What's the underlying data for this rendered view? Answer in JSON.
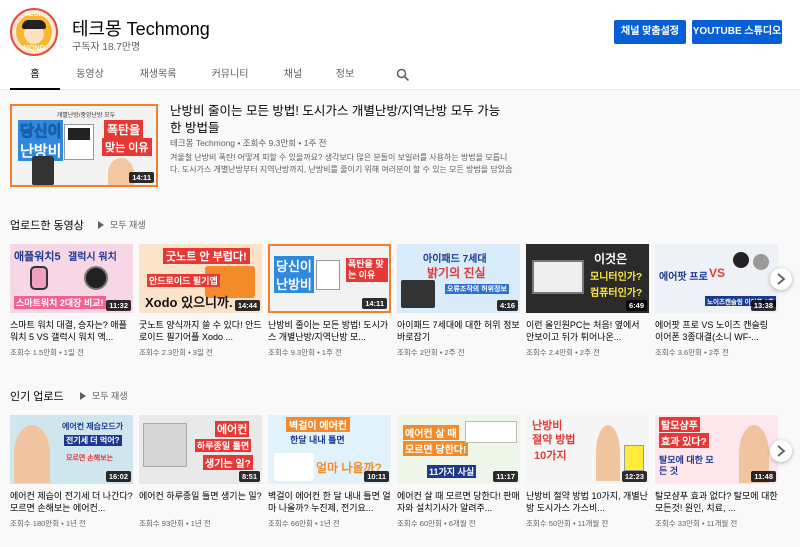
{
  "channel": {
    "avatar_text_top": "TECH",
    "avatar_text_bottom": "MONG",
    "name": "테크몽 Techmong",
    "subscribers": "구독자 18.7만명",
    "customize_label": "채널 맞춤설정",
    "studio_label": "YOUTUBE 스튜디오"
  },
  "tabs": [
    {
      "label": "홈"
    },
    {
      "label": "동영상"
    },
    {
      "label": "재생목록"
    },
    {
      "label": "커뮤니티"
    },
    {
      "label": "채널"
    },
    {
      "label": "정보"
    }
  ],
  "featured": {
    "title": "난방비 줄이는 모든 방법! 도시가스 개별난방/지역난방 모두 가능한 방법들",
    "meta": "테크몽 Techmong • 조회수 9.3만회 • 1주 전",
    "description_1": "겨울철 난방비 폭탄! 어떻게 피할 수 있을까요? 생각보다 많은 분들이 보일러를 사용하는 방법을 모릅니",
    "description_2": "다. 도시가스 개별난방부터 지역난방까지, 난방비를 줄이기 위해 여러분이 할 수 있는 모든 방법을 담았습",
    "duration": "14:11",
    "thumb_text_1": "당신이",
    "thumb_text_2": "난방비",
    "thumb_text_3": "폭탄을",
    "thumb_text_4": "맞는 이유",
    "thumb_text_top": "개별난방/중앙난방 모두"
  },
  "uploads": {
    "title": "업로드한 동영상",
    "play_all": "모두 재생",
    "videos": [
      {
        "title": "스마트 워치 대결, 승자는? 애플워치 5 VS 갤럭시 워치 액...",
        "meta": "조회수 1.5만회 • 1일 전",
        "duration": "11:32",
        "t1": "애플워치5",
        "t2": "갤럭시 워치",
        "t3": "스마트워치 2대장 비교!"
      },
      {
        "title": "굿노트 양식까지 쓸 수 있다! 안드로이드 필기어플 Xodo ...",
        "meta": "조회수 2.3만회 • 3일 전",
        "duration": "14:44",
        "t1": "굿노트 안 부럽다!",
        "t2": "안드로이드 필기앱",
        "t3": "Xodo 있으니까."
      },
      {
        "title": "난방비 줄이는 모든 방법! 도시가스 개별난방/지역난방 모...",
        "meta": "조회수 9.3만회 • 1주 전",
        "duration": "14:11",
        "t1": "당신이",
        "t2": "난방비",
        "t3": "폭탄을 맞는 이유"
      },
      {
        "title": "아이패드 7세대에 대한 허위 정보 바로잡기",
        "meta": "조회수 2만회 • 2주 전",
        "duration": "4:16",
        "t1": "아이패드 7세대",
        "t2": "밝기의 진실",
        "t3": "오류조작의 허위정보"
      },
      {
        "title": "이런 올인원PC는 처음! 옆에서 안보이고 뒤가 튀어나온...",
        "meta": "조회수 2.4만회 • 2주 전",
        "duration": "6:49",
        "t1": "이것은",
        "t2": "모니터인가?",
        "t3": "컴퓨터인가?"
      },
      {
        "title": "에어팟 프로 VS 노이즈 캔슬링 이어폰 3종대결(소니 WF-...",
        "meta": "조회수 3.6만회 • 2주 전",
        "duration": "13:38",
        "t1": "에어팟 프로",
        "t2": "VS",
        "t3": "노이즈캔슬링 이어폰 3종"
      }
    ]
  },
  "popular": {
    "title": "인기 업로드",
    "play_all": "모두 재생",
    "videos": [
      {
        "title": "에어컨 제습이 전기세 더 나간다? 모르면 손해보는 에어컨...",
        "meta": "조회수 180만회 • 1년 전",
        "duration": "16:02",
        "t1": "에어컨 제습모드가",
        "t2": "전기세 더 먹어?",
        "t3": "모르면 손해보는"
      },
      {
        "title": "에어컨 하루종일 틀면 생기는 일?",
        "meta": "조회수 93만회 • 1년 전",
        "duration": "8:51",
        "t1": "에어컨",
        "t2": "하루종일 틀면",
        "t3": "생기는 일?"
      },
      {
        "title": "벽걸이 에어컨 한 달 내내 틀면 얼마 나올까? 누진제, 전기요...",
        "meta": "조회수 66만회 • 1년 전",
        "duration": "10:11",
        "t1": "벽걸이 에어컨",
        "t2": "한달 내내 틀면",
        "t3": "얼마 나올까?"
      },
      {
        "title": "에어컨 살 때 모르면 당한다! 판매자와 설치기사가 알려주...",
        "meta": "조회수 60만회 • 6개월 전",
        "duration": "11:17",
        "t1": "에어컨 살 때",
        "t2": "모르면 당한다!",
        "t3": "11가지 사실"
      },
      {
        "title": "난방비 절약 방법 10가지, 개별난방 도시가스 가스비...",
        "meta": "조회수 50만회 • 11개월 전",
        "duration": "12:23",
        "t1": "난방비",
        "t2": "절약 방법",
        "t3": "10가지"
      },
      {
        "title": "탈모샴푸 효과 없다? 탈모에 대한 모든것! 원인, 치료, ...",
        "meta": "조회수 33만회 • 11개월 전",
        "duration": "11:48",
        "t1": "탈모샴푸",
        "t2": "효과 있다?",
        "t3": "탈모에 대한 모든 것"
      }
    ]
  }
}
